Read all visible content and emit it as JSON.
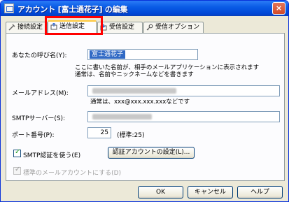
{
  "window": {
    "title": "アカウント [富士通花子] の編集",
    "close_label": "×"
  },
  "tabs": [
    {
      "label": "接続設定",
      "icon": "plug-icon"
    },
    {
      "label": "送信設定",
      "icon": "send-icon"
    },
    {
      "label": "受信設定",
      "icon": "receive-icon"
    },
    {
      "label": "受信オプション",
      "icon": "key-icon"
    }
  ],
  "form": {
    "name_label": "あなたの呼び名(Y):",
    "name_value": "富士通花子",
    "name_note": "ここに書いた名前が、相手のメールアプリケーションに表示されます\n通常は、名前やニックネームなどを書きます",
    "email_label": "メールアドレス(M):",
    "email_note": "通常は、xxx@xxx.xxx.xxxなどです",
    "smtp_label": "SMTPサーバー(S):",
    "port_label": "ポート番号(P):",
    "port_value": "25",
    "port_default": "(標準:25)",
    "smtp_auth_label": "SMTP認証を使う(E)",
    "smtp_auth_checked": true,
    "auth_account_button": "認証アカウントの設定(L)...",
    "default_account_label": "標準のメールアカウントにする(D)",
    "default_account_checked": true
  },
  "footer": {
    "ok": "OK",
    "cancel": "キャンセル",
    "help": "ヘルプ"
  },
  "colors": {
    "highlight": "#ff0000",
    "titlebar": "#0a5ce6",
    "selection": "#316ac5"
  }
}
